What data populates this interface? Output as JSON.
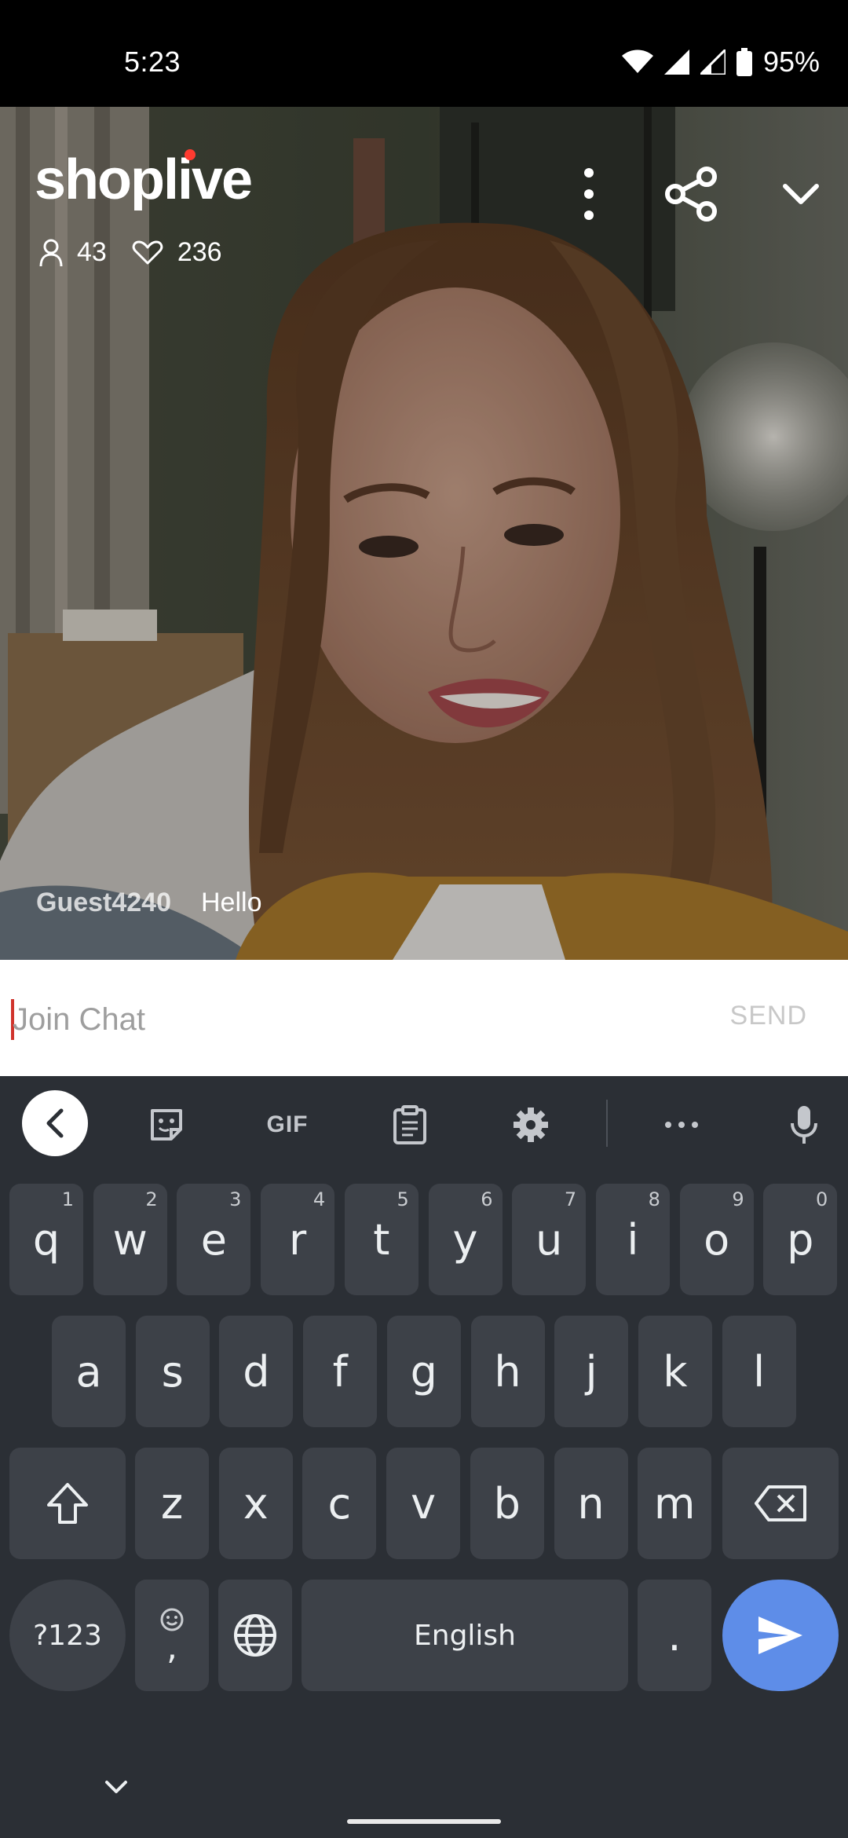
{
  "status_bar": {
    "time": "5:23",
    "battery": "95%"
  },
  "live": {
    "logo": "shoplive",
    "viewers": "43",
    "likes": "236"
  },
  "chat": {
    "messages": [
      {
        "user": "Guest4240",
        "text": "Hello"
      }
    ],
    "input_placeholder": "Join Chat",
    "send_label": "SEND"
  },
  "keyboard": {
    "toolbar": {
      "gif_label": "GIF"
    },
    "row1": [
      {
        "key": "q",
        "hint": "1"
      },
      {
        "key": "w",
        "hint": "2"
      },
      {
        "key": "e",
        "hint": "3"
      },
      {
        "key": "r",
        "hint": "4"
      },
      {
        "key": "t",
        "hint": "5"
      },
      {
        "key": "y",
        "hint": "6"
      },
      {
        "key": "u",
        "hint": "7"
      },
      {
        "key": "i",
        "hint": "8"
      },
      {
        "key": "o",
        "hint": "9"
      },
      {
        "key": "p",
        "hint": "0"
      }
    ],
    "row2": [
      "a",
      "s",
      "d",
      "f",
      "g",
      "h",
      "j",
      "k",
      "l"
    ],
    "row3": [
      "z",
      "x",
      "c",
      "v",
      "b",
      "n",
      "m"
    ],
    "symbols_label": "?123",
    "comma_label": ",",
    "space_label": "English",
    "period_label": "."
  },
  "colors": {
    "accent_send": "#5e8de8",
    "logo_dot": "#ff3b30",
    "keyboard_bg": "#2b2f35",
    "key_bg": "#3d4148"
  }
}
